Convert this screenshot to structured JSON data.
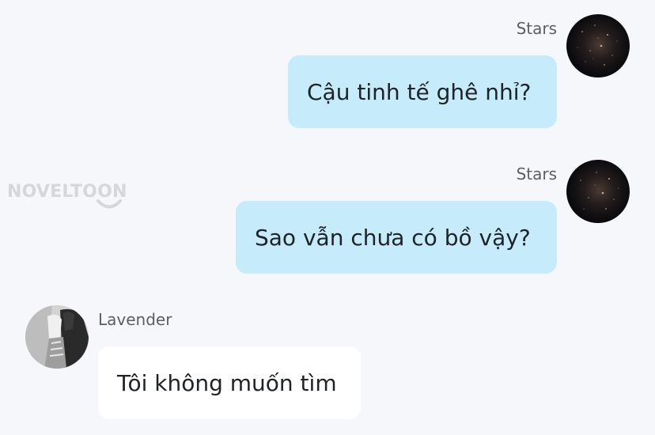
{
  "watermark": {
    "text": "NOVELTOON"
  },
  "messages": [
    {
      "sender": "Stars",
      "text": "Cậu tinh tế ghê nhỉ?",
      "side": "right",
      "avatar_icon": "night-sky-avatar"
    },
    {
      "sender": "Stars",
      "text": "Sao vẫn chưa có bồ vậy?",
      "side": "right",
      "avatar_icon": "night-sky-avatar"
    },
    {
      "sender": "Lavender",
      "text": "Tôi không muốn tìm",
      "side": "left",
      "avatar_icon": "person-avatar"
    }
  ],
  "colors": {
    "background": "#f5f7fa",
    "outgoing_bubble": "#c6ecfb",
    "incoming_bubble": "#ffffff",
    "sender_text": "#5b5f64",
    "message_text": "#1f2226",
    "watermark": "#d4d7db"
  }
}
